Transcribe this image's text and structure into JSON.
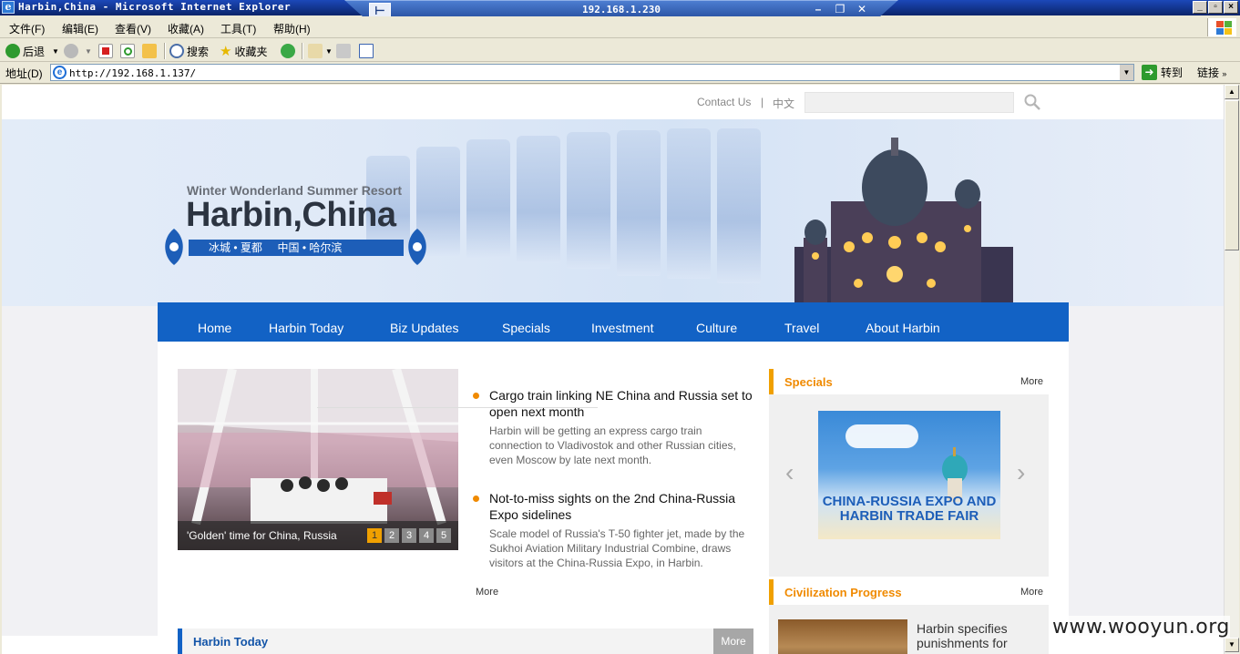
{
  "window": {
    "title": "Harbin,China - Microsoft Internet Explorer",
    "remote_host": "192.168.1.230",
    "controls": [
      "_",
      "□",
      "×"
    ]
  },
  "menu": [
    "文件(F)",
    "编辑(E)",
    "查看(V)",
    "收藏(A)",
    "工具(T)",
    "帮助(H)"
  ],
  "toolbar": {
    "back": "后退",
    "search": "搜索",
    "favorites": "收藏夹"
  },
  "addressbar": {
    "label": "地址(D)",
    "url": "http://192.168.1.137/",
    "go": "转到",
    "links": "链接"
  },
  "site": {
    "top": {
      "contact": "Contact Us",
      "separator": "|",
      "language": "中文",
      "search_placeholder": ""
    },
    "banner": {
      "tagline": "Winter Wonderland  Summer Resort",
      "title": "Harbin,China",
      "ribbon": "冰城 • 夏都     中国 • 哈尔滨"
    },
    "nav": [
      "Home",
      "Harbin Today",
      "Biz Updates",
      "Specials",
      "Investment",
      "Culture",
      "Travel",
      "About Harbin"
    ],
    "slideshow": {
      "caption": "'Golden' time for China, Russia",
      "pages": [
        "1",
        "2",
        "3",
        "4",
        "5"
      ],
      "active_page": 1
    },
    "news": [
      {
        "title": "Cargo train linking NE China and Russia set to open next month",
        "summary": "Harbin will be getting an express cargo train connection to Vladivostok and other Russian cities, even Moscow by late next month."
      },
      {
        "title": "Not-to-miss sights on the 2nd China-Russia Expo sidelines",
        "summary": "Scale model of Russia's T-50 fighter jet, made by the Sukhoi Aviation Military Industrial Combine, draws visitors at the China-Russia Expo, in Harbin."
      }
    ],
    "news_more": "More",
    "harbin_today": {
      "title": "Harbin Today",
      "more": "More"
    },
    "specials": {
      "title": "Specials",
      "more": "More",
      "banner_line1": "CHINA-RUSSIA EXPO AND",
      "banner_line2": "HARBIN TRADE FAIR"
    },
    "civilization": {
      "title": "Civilization Progress",
      "more": "More",
      "item": "Harbin specifies punishments for"
    }
  },
  "watermark": "www.wooyun.org",
  "colors": {
    "nav_blue": "#1262c5",
    "accent_orange": "#f08a00",
    "title_bar": "#0a246a"
  }
}
